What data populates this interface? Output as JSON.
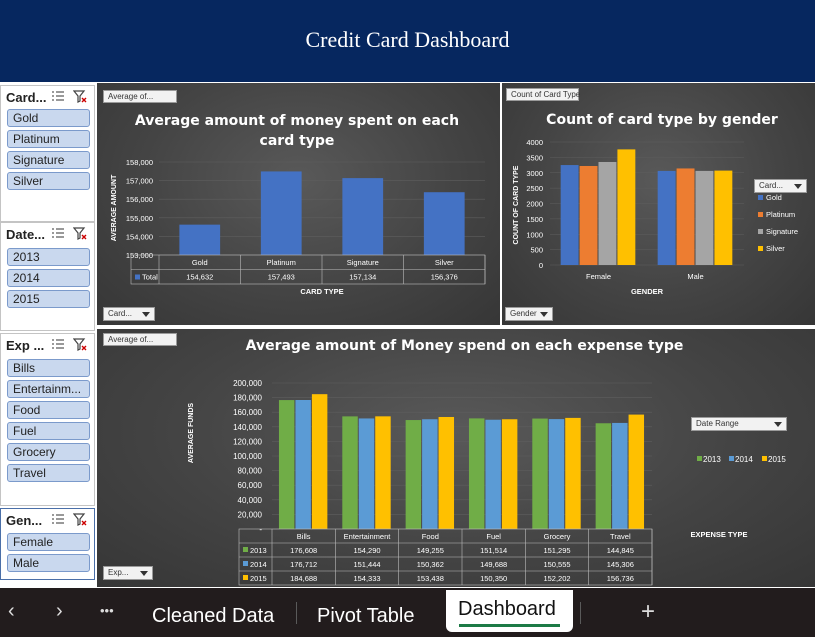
{
  "banner": {
    "title": "Credit Card Dashboard"
  },
  "slicers": [
    {
      "title": "Card...",
      "items": [
        "Gold",
        "Platinum",
        "Signature",
        "Silver"
      ]
    },
    {
      "title": "Date...",
      "items": [
        "2013",
        "2014",
        "2015"
      ]
    },
    {
      "title": "Exp ...",
      "items": [
        "Bills",
        "Entertainm...",
        "Food",
        "Fuel",
        "Grocery",
        "Travel"
      ]
    },
    {
      "title": "Gen...",
      "items": [
        "Female",
        "Male"
      ]
    }
  ],
  "chart1": {
    "field_button": "Average of...",
    "axis_filter_button": "Card...",
    "table_series_label": "Total"
  },
  "chart2": {
    "field_button": "Count of Card Type",
    "legend_filter_button": "Card...",
    "axis_filter_button": "Gender"
  },
  "chart3": {
    "field_button": "Average of...",
    "legend_filter_button": "Date Range",
    "axis_filter_button": "Exp..."
  },
  "chart_data": [
    {
      "type": "bar",
      "title": "Average amount of money spent on each card type",
      "xlabel": "CARD TYPE",
      "ylabel": "AVERAGE AMOUNT",
      "categories": [
        "Gold",
        "Platinum",
        "Signature",
        "Silver"
      ],
      "series": [
        {
          "name": "Total",
          "values": [
            154632,
            157493,
            157134,
            156376
          ]
        }
      ],
      "value_labels": [
        "154,632",
        "157,493",
        "157,134",
        "156,376"
      ],
      "yticks": [
        "158,000",
        "157,000",
        "156,000",
        "155,000",
        "154,000",
        "153,000"
      ],
      "ylim": [
        153000,
        158000
      ],
      "data_table": true,
      "colors": [
        "#4472c4"
      ]
    },
    {
      "type": "bar",
      "title": "Count of card type by gender",
      "xlabel": "GENDER",
      "ylabel": "COUNT OF CARD TYPE",
      "categories": [
        "Female",
        "Male"
      ],
      "series": [
        {
          "name": "Gold",
          "values": [
            3250,
            3060
          ]
        },
        {
          "name": "Platinum",
          "values": [
            3220,
            3140
          ]
        },
        {
          "name": "Signature",
          "values": [
            3350,
            3060
          ]
        },
        {
          "name": "Silver",
          "values": [
            3760,
            3070
          ]
        }
      ],
      "yticks": [
        "4000",
        "3500",
        "3000",
        "2500",
        "2000",
        "1500",
        "1000",
        "500",
        "0"
      ],
      "ylim": [
        0,
        4000
      ],
      "legend": "right",
      "colors": [
        "#4472c4",
        "#ed7d31",
        "#a5a5a5",
        "#ffc000"
      ]
    },
    {
      "type": "bar",
      "title": "Average amount of Money spend on each expense type",
      "xlabel": "EXPENSE TYPE",
      "ylabel": "AVERAGE FUNDS",
      "categories": [
        "Bills",
        "Entertainment",
        "Food",
        "Fuel",
        "Grocery",
        "Travel"
      ],
      "series": [
        {
          "name": "2013",
          "values": [
            176608,
            154290,
            149255,
            151514,
            151295,
            144845
          ],
          "labels": [
            "176,608",
            "154,290",
            "149,255",
            "151,514",
            "151,295",
            "144,845"
          ]
        },
        {
          "name": "2014",
          "values": [
            176712,
            151444,
            150362,
            149688,
            150555,
            145306
          ],
          "labels": [
            "176,712",
            "151,444",
            "150,362",
            "149,688",
            "150,555",
            "145,306"
          ]
        },
        {
          "name": "2015",
          "values": [
            184688,
            154333,
            153438,
            150350,
            152202,
            156736
          ],
          "labels": [
            "184,688",
            "154,333",
            "153,438",
            "150,350",
            "152,202",
            "156,736"
          ]
        }
      ],
      "yticks": [
        "200,000",
        "180,000",
        "160,000",
        "140,000",
        "120,000",
        "100,000",
        "80,000",
        "60,000",
        "40,000",
        "20,000",
        "-"
      ],
      "ylim": [
        0,
        200000
      ],
      "legend": "right",
      "data_table": true,
      "colors": [
        "#70ad47",
        "#5b9bd5",
        "#ffc000"
      ]
    }
  ],
  "tabs": {
    "prev_icon": "‹",
    "next_icon": "›",
    "more_icon": "•••",
    "items": [
      "Cleaned Data",
      "Pivot Table",
      "Dashboard"
    ],
    "active": "Dashboard",
    "add_icon": "+"
  }
}
